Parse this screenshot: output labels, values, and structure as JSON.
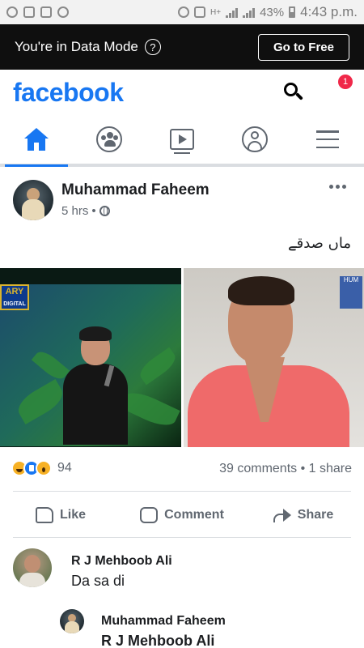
{
  "status_bar": {
    "battery": "43%",
    "time": "4:43 p.m.",
    "network": "H+"
  },
  "data_mode_bar": {
    "message": "You're in Data Mode",
    "help_icon": "?",
    "go_to_free": "Go to Free"
  },
  "header": {
    "logo": "facebook",
    "notification_count": "1"
  },
  "nav": {
    "items": [
      "home-icon",
      "groups-icon",
      "watch-icon",
      "profile-icon",
      "menu-icon"
    ],
    "active": "home"
  },
  "post": {
    "author": "Muhammad Faheem",
    "time": "5 hrs",
    "separator": "•",
    "caption": "ماں صدقے",
    "photo_badges": {
      "left_channel_top": "ARY",
      "left_channel_bottom": "DIGITAL",
      "right_channel": "HUM"
    },
    "reaction_count": "94",
    "comments_shares": "39 comments • 1 share",
    "actions": {
      "like": "Like",
      "comment": "Comment",
      "share": "Share"
    }
  },
  "comments": [
    {
      "author": "R J Mehboob Ali",
      "text": "Da sa di"
    },
    {
      "author": "Muhammad Faheem",
      "text": "R J Mehboob Ali"
    }
  ],
  "colors": {
    "brand": "#1877f2",
    "badge": "#f02849",
    "data_bar": "#0f0f0f"
  }
}
